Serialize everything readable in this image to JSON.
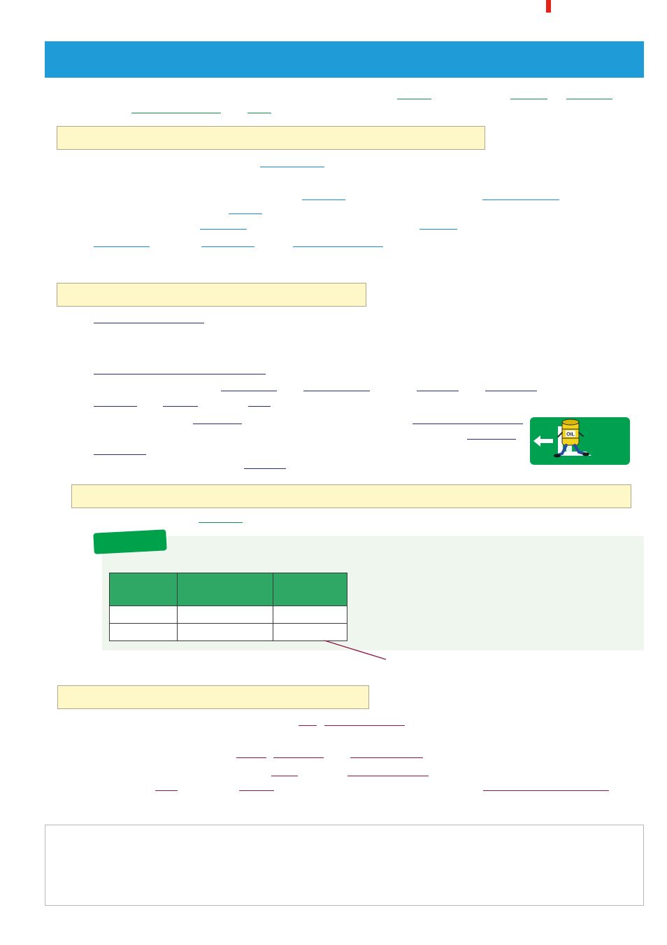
{
  "colors": {
    "title_bar": "#1f9cd8",
    "section_box_fill": "#fef8c8",
    "section_box_border": "#b5a787",
    "underline_green": "#16934a",
    "underline_blue": "#1c8ed0",
    "underline_navy": "#2a2f73",
    "underline_maroon": "#8f1a4a",
    "exit_sign": "#00a051",
    "example_badge": "#00a14b",
    "example_panel": "#eef6ee",
    "table_header": "#2fa865",
    "accent_red": "#e62117"
  },
  "icons": {
    "exit_sign": "running-oil-barrel-exit-icon",
    "exit_arrow": "left-arrow-icon",
    "barrel_label": "OIL"
  },
  "table": {
    "columns": 3,
    "header_rows": 1,
    "body_rows": 2
  }
}
